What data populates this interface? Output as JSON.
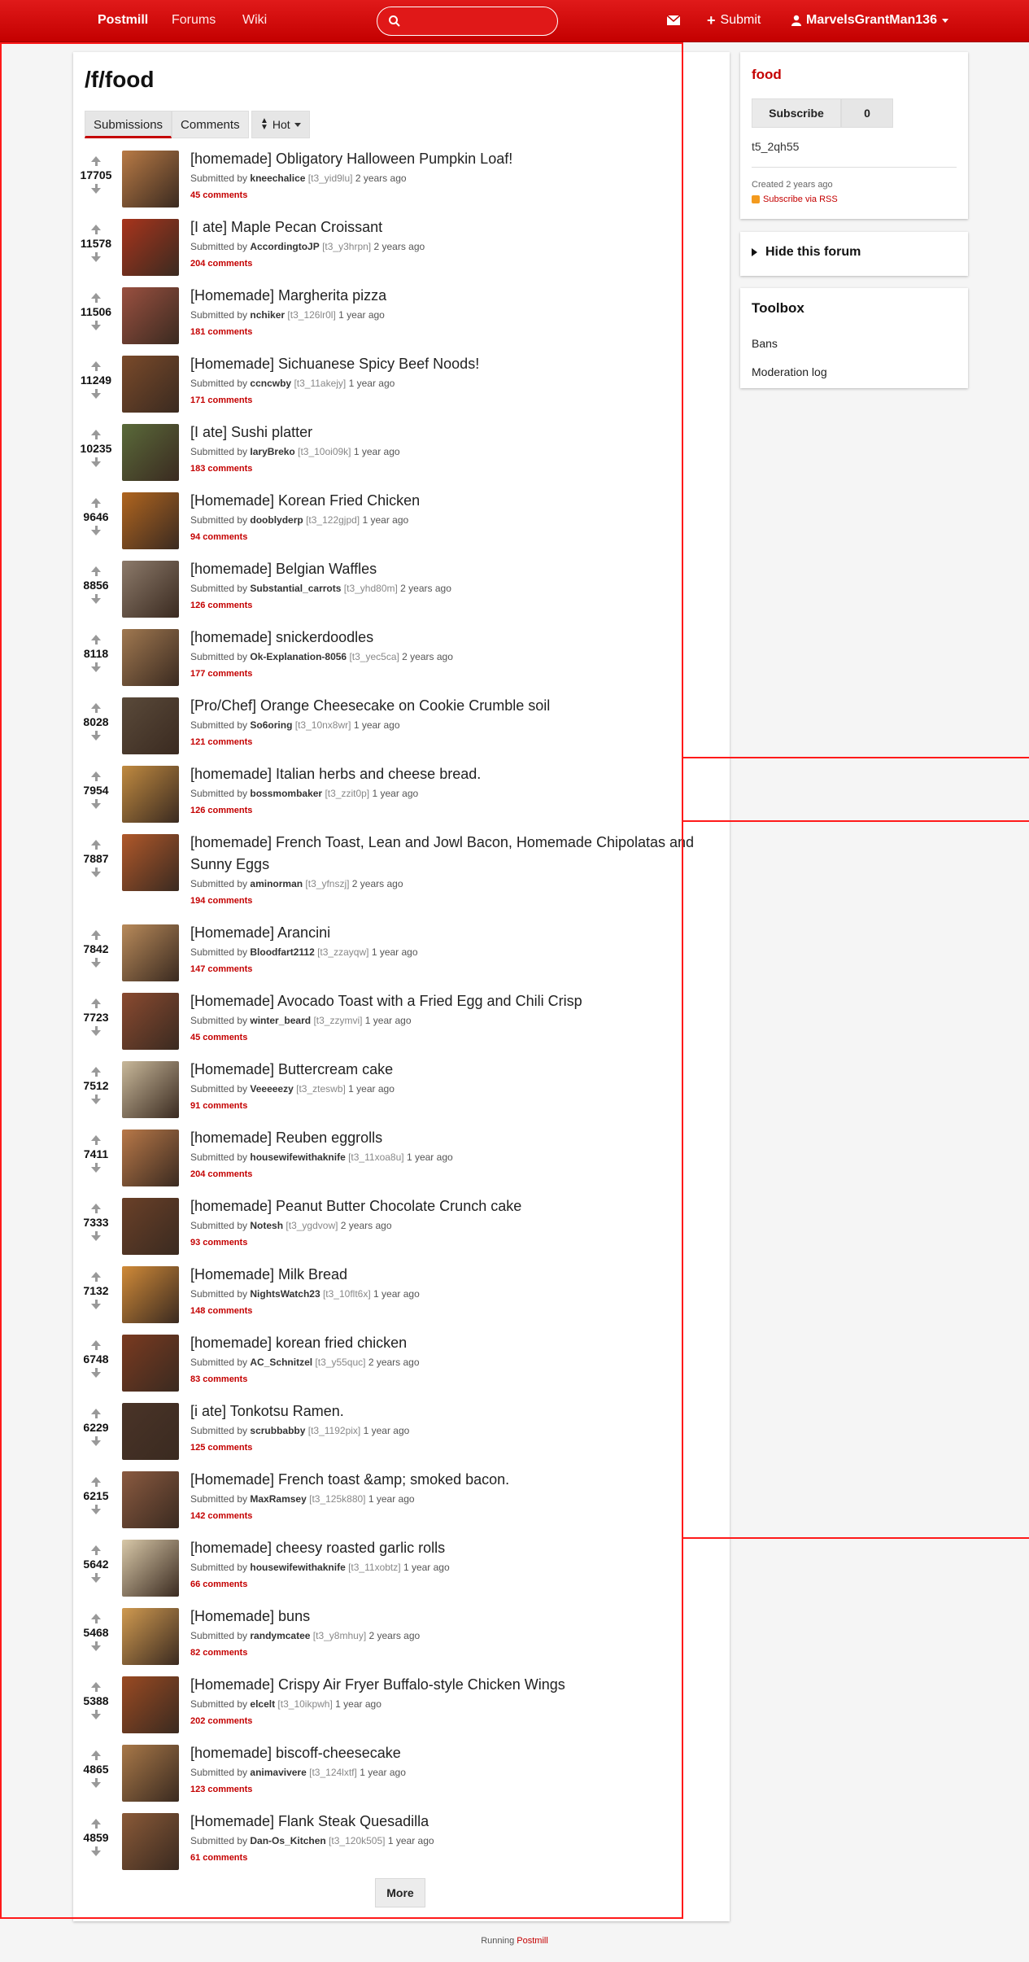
{
  "nav": {
    "brand": "Postmill",
    "forums": "Forums",
    "wiki": "Wiki",
    "search_value": "",
    "submit": "Submit",
    "user": "MarvelsGrantMan136"
  },
  "page": {
    "title": "/f/food",
    "tabs": [
      "Submissions",
      "Comments"
    ],
    "sort": "Hot"
  },
  "posts": [
    {
      "score": "17705",
      "title": "[homemade] Obligatory Halloween Pumpkin Loaf!",
      "submitted_by": "Submitted by",
      "author": "kneechalice",
      "id": "[t3_yid9lu]",
      "age": "2 years ago",
      "comments": "45 comments",
      "thumb_color": "#b87a45"
    },
    {
      "score": "11578",
      "title": "[I ate] Maple Pecan Croissant",
      "submitted_by": "Submitted by",
      "author": "AccordingtoJP",
      "id": "[t3_y3hrpn]",
      "age": "2 years ago",
      "comments": "204 comments",
      "thumb_color": "#a8341c"
    },
    {
      "score": "11506",
      "title": "[Homemade] Margherita pizza",
      "submitted_by": "Submitted by",
      "author": "nchiker",
      "id": "[t3_126lr0l]",
      "age": "1 year ago",
      "comments": "181 comments",
      "thumb_color": "#9a5040"
    },
    {
      "score": "11249",
      "title": "[Homemade] Sichuanese Spicy Beef Noods!",
      "submitted_by": "Submitted by",
      "author": "ccncwby",
      "id": "[t3_11akejy]",
      "age": "1 year ago",
      "comments": "171 comments",
      "thumb_color": "#7a4a2a"
    },
    {
      "score": "10235",
      "title": "[I ate] Sushi platter",
      "submitted_by": "Submitted by",
      "author": "IaryBreko",
      "id": "[t3_10oi09k]",
      "age": "1 year ago",
      "comments": "183 comments",
      "thumb_color": "#5a6a3a"
    },
    {
      "score": "9646",
      "title": "[Homemade] Korean Fried Chicken",
      "submitted_by": "Submitted by",
      "author": "dooblyderp",
      "id": "[t3_122gjpd]",
      "age": "1 year ago",
      "comments": "94 comments",
      "thumb_color": "#b0651f"
    },
    {
      "score": "8856",
      "title": "[homemade] Belgian Waffles",
      "submitted_by": "Submitted by",
      "author": "Substantial_carrots",
      "id": "[t3_yhd80m]",
      "age": "2 years ago",
      "comments": "126 comments",
      "thumb_color": "#8c7a6a"
    },
    {
      "score": "8118",
      "title": "[homemade] snickerdoodles",
      "submitted_by": "Submitted by",
      "author": "Ok-Explanation-8056",
      "id": "[t3_yec5ca]",
      "age": "2 years ago",
      "comments": "177 comments",
      "thumb_color": "#a07850"
    },
    {
      "score": "8028",
      "title": "[Pro/Chef] Orange Cheesecake on Cookie Crumble soil",
      "submitted_by": "Submitted by",
      "author": "So6oring",
      "id": "[t3_10nx8wr]",
      "age": "1 year ago",
      "comments": "121 comments",
      "thumb_color": "#5a4a3a"
    },
    {
      "score": "7954",
      "title": "[homemade] Italian herbs and cheese bread.",
      "submitted_by": "Submitted by",
      "author": "bossmombaker",
      "id": "[t3_zzit0p]",
      "age": "1 year ago",
      "comments": "126 comments",
      "thumb_color": "#c08a40"
    },
    {
      "score": "7887",
      "title": "[homemade] French Toast, Lean and Jowl Bacon, Homemade Chipolatas and Sunny Eggs",
      "submitted_by": "Submitted by",
      "author": "aminorman",
      "id": "[t3_yfnszj]",
      "age": "2 years ago",
      "comments": "194 comments",
      "thumb_color": "#b0582a"
    },
    {
      "score": "7842",
      "title": "[Homemade] Arancini",
      "submitted_by": "Submitted by",
      "author": "Bloodfart2112",
      "id": "[t3_zzayqw]",
      "age": "1 year ago",
      "comments": "147 comments",
      "thumb_color": "#b88a5a"
    },
    {
      "score": "7723",
      "title": "[Homemade] Avocado Toast with a Fried Egg and Chili Crisp",
      "submitted_by": "Submitted by",
      "author": "winter_beard",
      "id": "[t3_zzymvi]",
      "age": "1 year ago",
      "comments": "45 comments",
      "thumb_color": "#8a4a30"
    },
    {
      "score": "7512",
      "title": "[Homemade] Buttercream cake",
      "submitted_by": "Submitted by",
      "author": "Veeeeezy",
      "id": "[t3_zteswb]",
      "age": "1 year ago",
      "comments": "91 comments",
      "thumb_color": "#c8b89a"
    },
    {
      "score": "7411",
      "title": "[homemade] Reuben eggrolls",
      "submitted_by": "Submitted by",
      "author": "housewifewithaknife",
      "id": "[t3_11xoa8u]",
      "age": "1 year ago",
      "comments": "204 comments",
      "thumb_color": "#b87848"
    },
    {
      "score": "7333",
      "title": "[homemade] Peanut Butter Chocolate Crunch cake",
      "submitted_by": "Submitted by",
      "author": "Notesh",
      "id": "[t3_ygdvow]",
      "age": "2 years ago",
      "comments": "93 comments",
      "thumb_color": "#6a4028"
    },
    {
      "score": "7132",
      "title": "[Homemade] Milk Bread",
      "submitted_by": "Submitted by",
      "author": "NightsWatch23",
      "id": "[t3_10flt6x]",
      "age": "1 year ago",
      "comments": "148 comments",
      "thumb_color": "#d08a38"
    },
    {
      "score": "6748",
      "title": "[homemade] korean fried chicken",
      "submitted_by": "Submitted by",
      "author": "AC_Schnitzel",
      "id": "[t3_y55quc]",
      "age": "2 years ago",
      "comments": "83 comments",
      "thumb_color": "#7a3a20"
    },
    {
      "score": "6229",
      "title": "[i ate] Tonkotsu Ramen.",
      "submitted_by": "Submitted by",
      "author": "scrubbabby",
      "id": "[t3_1192pix]",
      "age": "1 year ago",
      "comments": "125 comments",
      "thumb_color": "#4a3428"
    },
    {
      "score": "6215",
      "title": "[Homemade] French toast &amp; smoked bacon.",
      "submitted_by": "Submitted by",
      "author": "MaxRamsey",
      "id": "[t3_125k880]",
      "age": "1 year ago",
      "comments": "142 comments",
      "thumb_color": "#8a5a40"
    },
    {
      "score": "5642",
      "title": "[homemade] cheesy roasted garlic rolls",
      "submitted_by": "Submitted by",
      "author": "housewifewithaknife",
      "id": "[t3_11xobtz]",
      "age": "1 year ago",
      "comments": "66 comments",
      "thumb_color": "#d8c8a8"
    },
    {
      "score": "5468",
      "title": "[Homemade] buns",
      "submitted_by": "Submitted by",
      "author": "randymcatee",
      "id": "[t3_y8mhuy]",
      "age": "2 years ago",
      "comments": "82 comments",
      "thumb_color": "#d09a50"
    },
    {
      "score": "5388",
      "title": "[Homemade] Crispy Air Fryer Buffalo-style Chicken Wings",
      "submitted_by": "Submitted by",
      "author": "elcelt",
      "id": "[t3_10ikpwh]",
      "age": "1 year ago",
      "comments": "202 comments",
      "thumb_color": "#9a4a22"
    },
    {
      "score": "4865",
      "title": "[homemade] biscoff-cheesecake",
      "submitted_by": "Submitted by",
      "author": "animavivere",
      "id": "[t3_124lxtf]",
      "age": "1 year ago",
      "comments": "123 comments",
      "thumb_color": "#a87848"
    },
    {
      "score": "4859",
      "title": "[Homemade] Flank Steak Quesadilla",
      "submitted_by": "Submitted by",
      "author": "Dan-Os_Kitchen",
      "id": "[t3_120k505]",
      "age": "1 year ago",
      "comments": "61 comments",
      "thumb_color": "#8a5a38"
    }
  ],
  "more": "More",
  "sidebar": {
    "forum_name": "food",
    "subscribe": "Subscribe",
    "subscriber_count": "0",
    "forum_id": "t5_2qh55",
    "created": "Created 2 years ago",
    "rss": "Subscribe via RSS",
    "hide_forum": "Hide this forum",
    "toolbox_title": "Toolbox",
    "toolbox_links": [
      "Bans",
      "Moderation log"
    ]
  },
  "footer": {
    "running": "Running",
    "brand": "Postmill"
  },
  "colors": {
    "accent": "#c40000",
    "nav_bg": "#e01a1a",
    "rss": "#f39a1e"
  }
}
